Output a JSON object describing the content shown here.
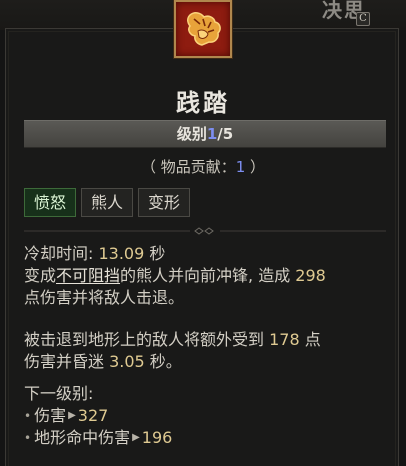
{
  "header": {
    "corner_text": "决思",
    "corner_key": "C"
  },
  "skill": {
    "icon": "bear-claw-icon",
    "title": "践踏",
    "rank_label": "级别",
    "rank_current": "1",
    "rank_sep_max": "/5",
    "contribution_prefix": "（ 物品贡献：",
    "contribution_value": "1",
    "contribution_suffix": " ）",
    "tags": [
      {
        "label": "愤怒",
        "active": true
      },
      {
        "label": "熊人",
        "active": false
      },
      {
        "label": "变形",
        "active": false
      }
    ]
  },
  "description": {
    "cooldown_label": "冷却时间: ",
    "cooldown_value": "13.09",
    "cooldown_unit": " 秒",
    "line2_a": "变成",
    "line2_unstoppable": "不可阻挡",
    "line2_b": "的熊人并向前冲锋, 造成 ",
    "line2_damage": "298",
    "line3": "点伤害并将敌人击退。",
    "para2_a": "被击退到地形上的敌人将额外受到 ",
    "para2_damage": "178",
    "para2_b": " 点",
    "para2_c": "伤害并昏迷 ",
    "para2_stun": "3.05",
    "para2_d": " 秒。",
    "next_rank_label": "下一级别:",
    "next_rank_stats": [
      {
        "label": "伤害",
        "value": "327"
      },
      {
        "label": "地形命中伤害",
        "value": "196"
      }
    ]
  },
  "colors": {
    "rank_highlight": "#7d8ef0",
    "number": "#dfca92",
    "active_tag_bg": "#17301a",
    "icon_bg": "#8e1c10",
    "icon_border": "#b0874d"
  }
}
